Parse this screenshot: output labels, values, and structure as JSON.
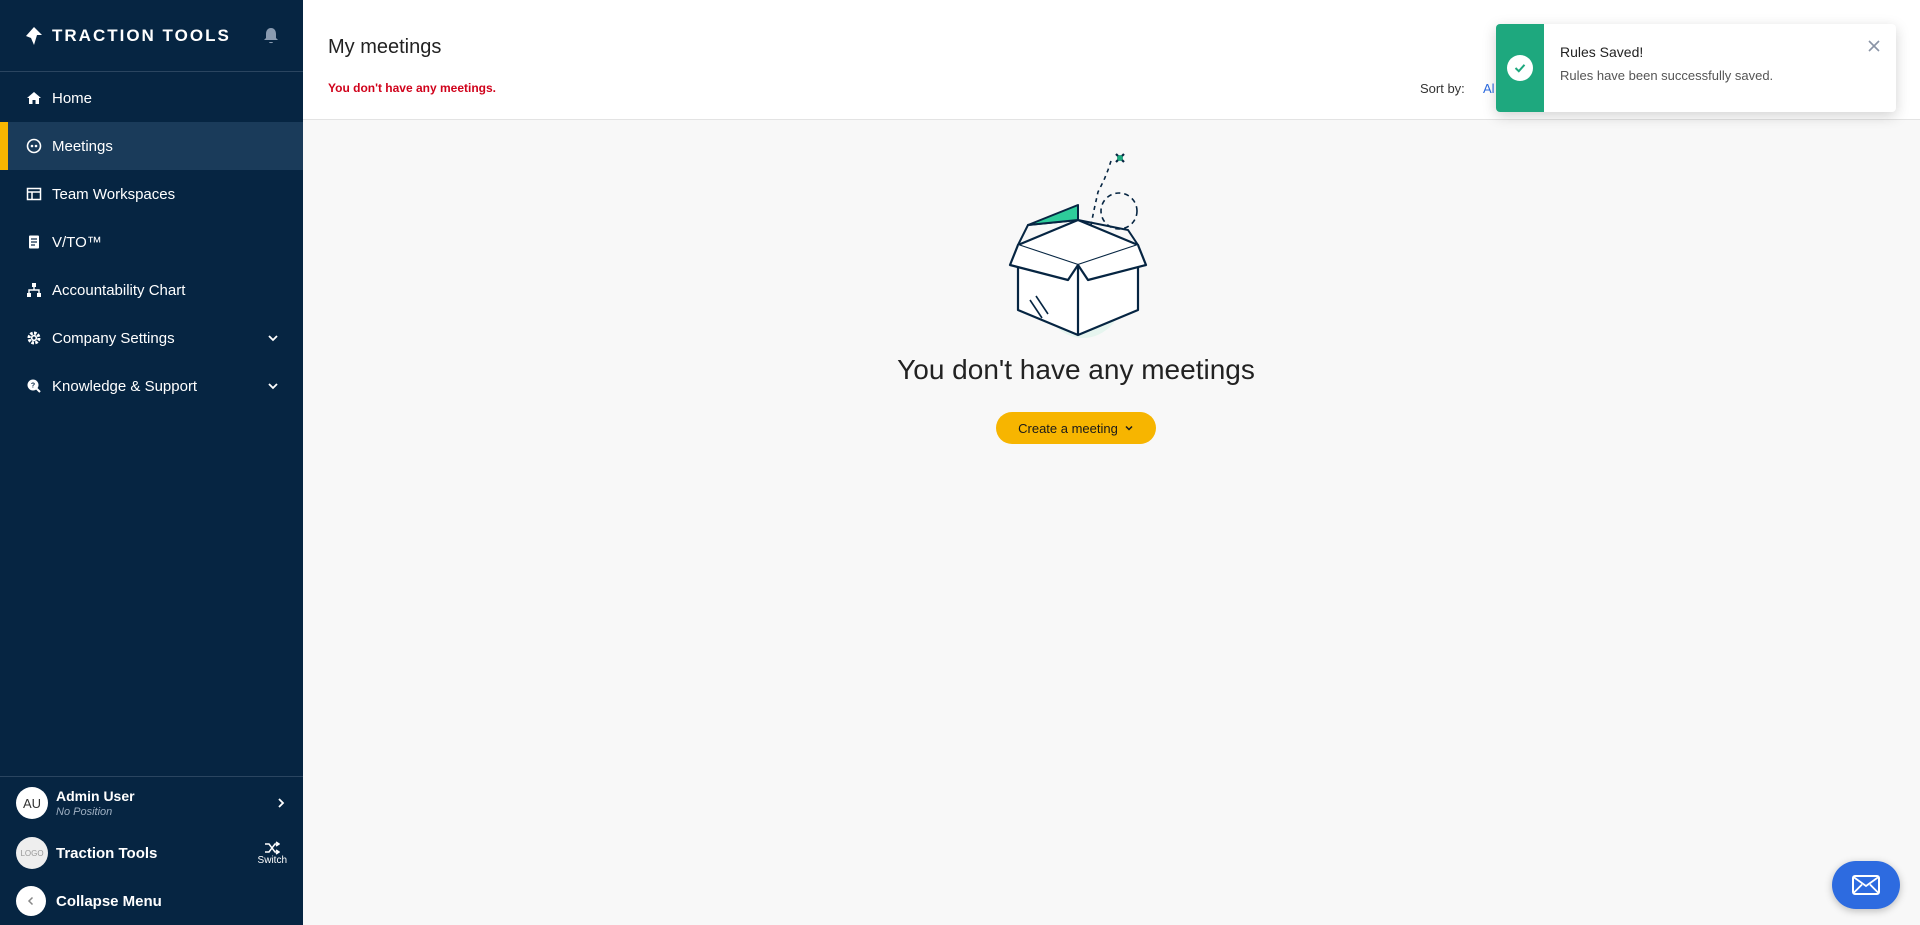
{
  "brand": {
    "name": "TRACTION TOOLS"
  },
  "sidebar": {
    "items": [
      {
        "label": "Home",
        "icon": "home-icon"
      },
      {
        "label": "Meetings",
        "icon": "meetings-icon",
        "active": true
      },
      {
        "label": "Team Workspaces",
        "icon": "workspace-icon"
      },
      {
        "label": "V/TO™",
        "icon": "document-icon"
      },
      {
        "label": "Accountability Chart",
        "icon": "org-chart-icon"
      },
      {
        "label": "Company Settings",
        "icon": "gear-icon",
        "expandable": true
      },
      {
        "label": "Knowledge & Support",
        "icon": "support-icon",
        "expandable": true
      }
    ]
  },
  "user": {
    "initials": "AU",
    "name": "Admin User",
    "position": "No Position"
  },
  "org": {
    "logo_text": "LOGO",
    "name": "Traction Tools",
    "switch_label": "Switch"
  },
  "collapse": {
    "label": "Collapse Menu"
  },
  "header": {
    "title": "My meetings",
    "notice": "You don't have any meetings.",
    "sort_label": "Sort by:",
    "sort_value": "Al"
  },
  "empty_state": {
    "title": "You don't have any meetings",
    "button_label": "Create a meeting"
  },
  "toast": {
    "title": "Rules Saved!",
    "message": "Rules have been successfully saved."
  },
  "colors": {
    "sidebar_bg": "#062542",
    "accent": "#f7b500",
    "success": "#1ea87e",
    "notice": "#d0021b",
    "link": "#2d6be0"
  }
}
